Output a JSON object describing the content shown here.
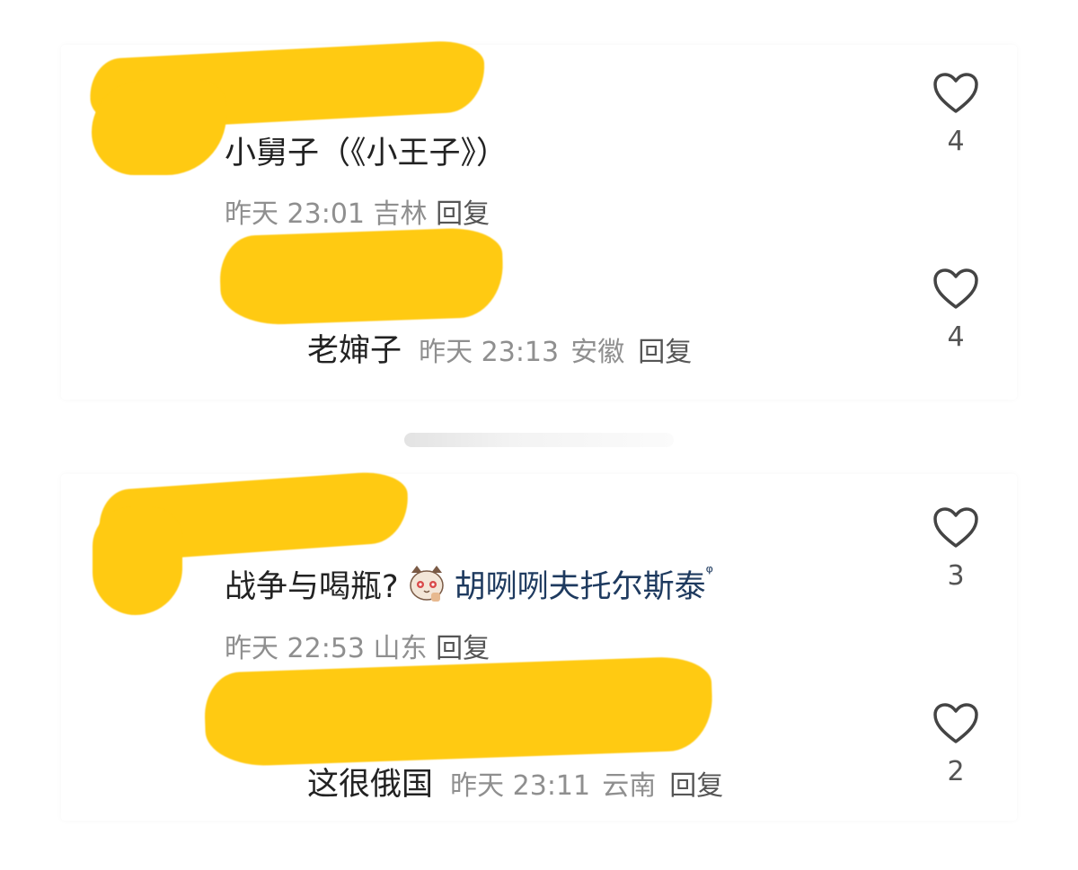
{
  "comments": [
    {
      "text": "小舅子（《小王子》）",
      "time": "昨天 23:01",
      "location": "吉林",
      "reply_label": "回复",
      "likes": "4",
      "replies": [
        {
          "text": "老婶子",
          "time": "昨天 23:13",
          "location": "安徽",
          "reply_label": "回复",
          "likes": "4"
        }
      ]
    },
    {
      "text": "战争与喝瓶?",
      "mention": "胡咧咧夫托尔斯泰",
      "mention_suffix": "ᵠ",
      "time": "昨天 22:53",
      "location": "山东",
      "reply_label": "回复",
      "likes": "3",
      "replies": [
        {
          "text": "这很俄国",
          "time": "昨天 23:11",
          "location": "云南",
          "reply_label": "回复",
          "likes": "2"
        }
      ]
    }
  ],
  "icons": {
    "like": "heart-outline-icon",
    "sticker": "cat-sticker-icon"
  },
  "colors": {
    "redaction": "#FFCA12",
    "mention": "#1e3a5f",
    "meta": "#8f8f8f"
  }
}
